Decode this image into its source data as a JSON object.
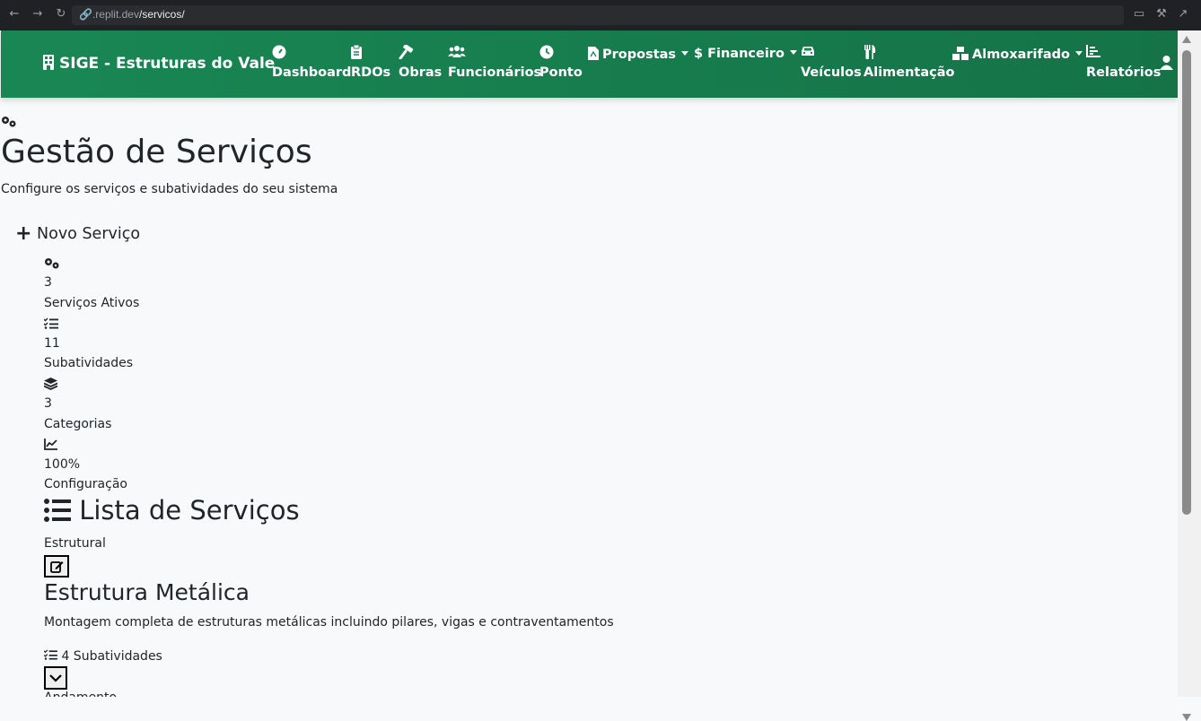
{
  "browser": {
    "url_host": ".replit.dev",
    "url_path": "/servicos/"
  },
  "navbar": {
    "brand": "SIGE - Estruturas do Vale",
    "items": [
      {
        "label": "Dashboard",
        "icon": "gauge-icon"
      },
      {
        "label": "RDOs",
        "icon": "clipboard-icon"
      },
      {
        "label": "Obras",
        "icon": "hammer-icon"
      },
      {
        "label": "Funcionários",
        "icon": "users-icon"
      },
      {
        "label": "Ponto",
        "icon": "clock-icon"
      },
      {
        "label": "Propostas",
        "icon": "file-pdf-icon",
        "dropdown": true
      },
      {
        "label": "Financeiro",
        "icon": "dollar-icon",
        "dropdown": true
      },
      {
        "label": "Veículos",
        "icon": "car-icon"
      },
      {
        "label": "Alimentação",
        "icon": "utensils-icon"
      },
      {
        "label": "Almoxarifado",
        "icon": "boxes-icon",
        "dropdown": true
      },
      {
        "label": "Relatórios",
        "icon": "chart-icon"
      }
    ],
    "user_icon": "user-icon",
    "colors": {
      "start": "#198754",
      "end": "#157347"
    }
  },
  "page": {
    "title": "Gestão de Serviços",
    "subtitle": "Configure os serviços e subatividades do seu sistema",
    "new_button": "Novo Serviço",
    "stats": [
      {
        "icon": "cogs-icon",
        "value": "3",
        "label": "Serviços Ativos"
      },
      {
        "icon": "list-check-icon",
        "value": "11",
        "label": "Subatividades"
      },
      {
        "icon": "layers-icon",
        "value": "3",
        "label": "Categorias"
      },
      {
        "icon": "chart-line-icon",
        "value": "100%",
        "label": "Configuração"
      }
    ],
    "list_title": "Lista de Serviços",
    "service": {
      "category": "Estrutural",
      "name": "Estrutura Metálica",
      "description": "Montagem completa de estruturas metálicas incluindo pilares, vigas e contraventamentos",
      "subactivities": "4 Subatividades",
      "next_item_partial": "Andamento"
    }
  }
}
